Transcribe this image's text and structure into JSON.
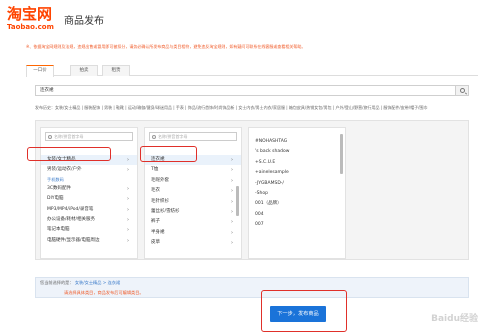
{
  "header": {
    "logo_cn": "淘宝网",
    "logo_en": "Taobao.com",
    "page_title": "商品发布"
  },
  "notice": "※、依据淘宝网规则及法规，违规出售或冒用即可被扣分，请务必确认所发布商品与类目相符，避免违反淘宝规则，如有疑问可联系在线客服或查看相关帮助。",
  "tabs": [
    {
      "label": "一口价"
    },
    {
      "label": "拍卖"
    },
    {
      "label": "租赁"
    }
  ],
  "search": {
    "value": "连衣裙"
  },
  "hot_categories": "发布历史：女装/女士精品 | 服装配饰 | 男装 | 鞋靴 | 运动/瑜伽/健身/球迷用品 | 手表 | 饰品/流行首饰/时尚饰品新 | 女士内衣/男士内衣/家居服 | 箱包皮具/热销女包/男包 | 户外/登山/野营/旅行用品 | 服饰配件/皮带/帽子/围巾",
  "columns": {
    "col1": {
      "placeholder": "名称/拼音首字母",
      "items": [
        {
          "label": "女装/女士精品"
        },
        {
          "label": "男装/运动衣/户外"
        },
        {
          "label": "手机数码"
        },
        {
          "label": "3C数码配件"
        },
        {
          "label": "DIY电脑"
        },
        {
          "label": "MP3/MP4/iPod/录音笔"
        },
        {
          "label": "办公设备/耗材/相关服务"
        },
        {
          "label": "笔记本电脑"
        },
        {
          "label": "电脑硬件/显示器/电脑周边"
        }
      ]
    },
    "col2": {
      "placeholder": "名称/拼音首字母",
      "items": [
        {
          "label": "连衣裙"
        },
        {
          "label": "T恤"
        },
        {
          "label": "毛呢外套"
        },
        {
          "label": "毛衣"
        },
        {
          "label": "毛针织衫"
        },
        {
          "label": "蕾丝衫/雪纺衫"
        },
        {
          "label": "裤子"
        },
        {
          "label": "半身裙"
        },
        {
          "label": "皮草"
        }
      ]
    },
    "col3": {
      "items": [
        {
          "label": "#NOHASHTAG"
        },
        {
          "label": "'s back shadow"
        },
        {
          "label": "+S.C.U.E"
        },
        {
          "label": "+ainelesample"
        },
        {
          "label": "-JYGBAMSD-/"
        },
        {
          "label": "-Shop"
        },
        {
          "label": "001（品牌）"
        },
        {
          "label": "004"
        },
        {
          "label": "007"
        }
      ]
    }
  },
  "selected": {
    "label": "您当前选择的是：",
    "path": "女装/女士精品 > 连衣裙"
  },
  "warning": "请选择具体类目，商品发布后可编辑类目。",
  "next_button": "下一步，发布商品",
  "watermark": "Baidu经验"
}
